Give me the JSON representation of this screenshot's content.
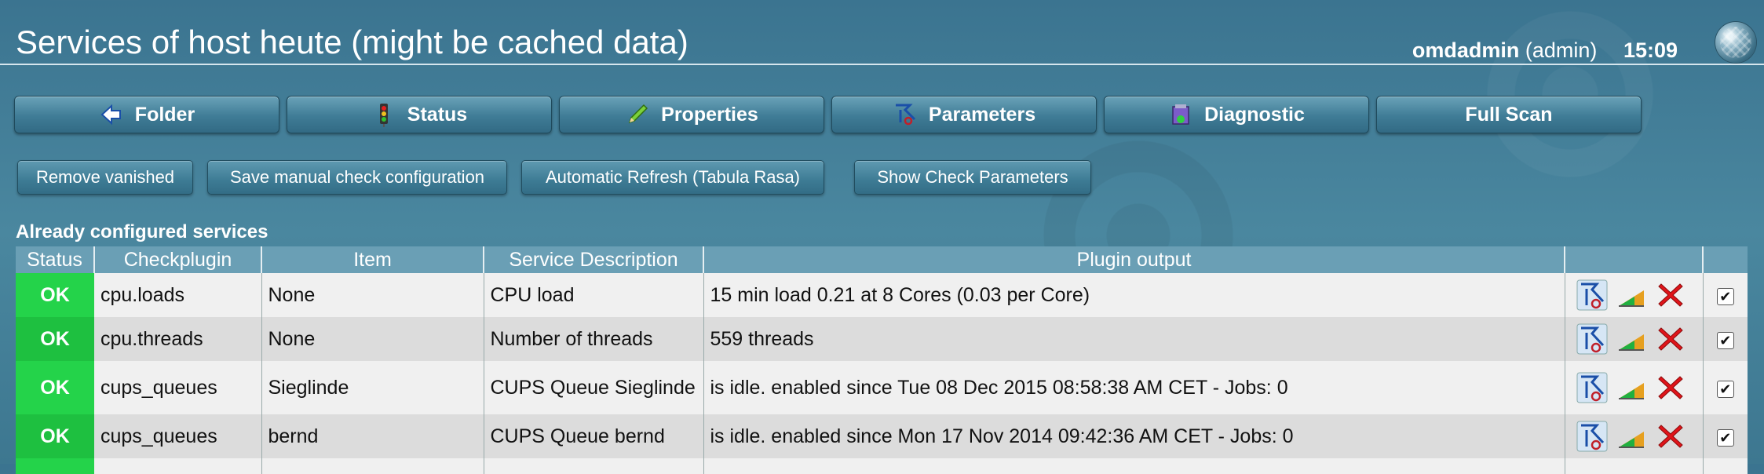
{
  "header": {
    "title": "Services of host heute (might be cached data)",
    "username": "omdadmin",
    "role": "(admin)",
    "clock": "15:09"
  },
  "nav": [
    {
      "label": "Folder",
      "icon": "back-arrow-icon"
    },
    {
      "label": "Status",
      "icon": "traffic-light-icon"
    },
    {
      "label": "Properties",
      "icon": "pencil-icon"
    },
    {
      "label": "Parameters",
      "icon": "rulesets-icon"
    },
    {
      "label": "Diagnostic",
      "icon": "diagnose-icon"
    },
    {
      "label": "Full Scan",
      "icon": ""
    }
  ],
  "actions": {
    "remove_vanished": "Remove vanished",
    "save_manual": "Save manual check configuration",
    "auto_refresh": "Automatic Refresh (Tabula Rasa)",
    "show_params": "Show Check Parameters"
  },
  "section_title": "Already configured services",
  "table": {
    "headers": [
      "Status",
      "Checkplugin",
      "Item",
      "Service Description",
      "Plugin output"
    ],
    "rows": [
      {
        "status": "OK",
        "plugin": "cpu.loads",
        "item": "None",
        "description": "CPU load",
        "output": "15 min load 0.21 at 8 Cores (0.03 per Core)"
      },
      {
        "status": "OK",
        "plugin": "cpu.threads",
        "item": "None",
        "description": "Number of threads",
        "output": "559 threads"
      },
      {
        "status": "OK",
        "plugin": "cups_queues",
        "item": "Sieglinde",
        "description": "CUPS Queue Sieglinde",
        "output": "is idle. enabled since Tue 08 Dec 2015 08:58:38 AM CET - Jobs: 0"
      },
      {
        "status": "OK",
        "plugin": "cups_queues",
        "item": "bernd",
        "description": "CUPS Queue bernd",
        "output": "is idle. enabled since Mon 17 Nov 2014 09:42:36 AM CET - Jobs: 0"
      }
    ]
  },
  "colors": {
    "ok": "#24d34a",
    "header_bg": "#6a9fb5",
    "row_odd": "#f0f0f0",
    "row_even": "#dcdcdc",
    "delete_icon": "#e0141a"
  }
}
